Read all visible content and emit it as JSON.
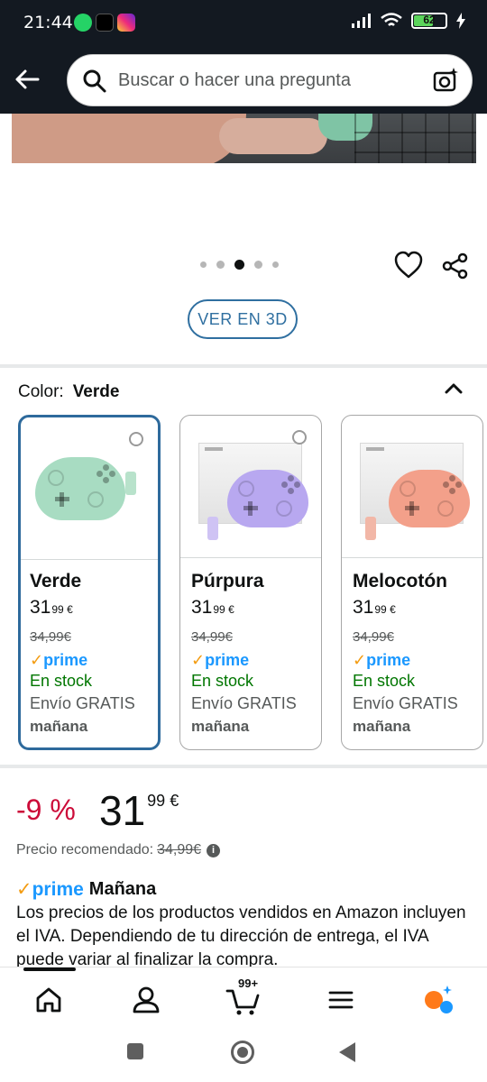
{
  "status_bar": {
    "time": "21:44",
    "battery": "62",
    "battery_level": 0.62
  },
  "search": {
    "placeholder": "Buscar o hacer una pregunta"
  },
  "carousel": {
    "dot_count": 5,
    "active_index": 2,
    "view_3d_label": "VER EN 3D"
  },
  "color": {
    "label": "Color:",
    "selected": "Verde"
  },
  "variants": [
    {
      "name": "Verde",
      "price_whole": "31",
      "price_cents": "99",
      "currency": "€",
      "old_price": "34,99€",
      "prime_check": "✓",
      "prime_word": "prime",
      "stock": "En stock",
      "shipping": "Envío GRATIS",
      "delivery": "mañana",
      "color": "#a8dcc2"
    },
    {
      "name": "Púrpura",
      "price_whole": "31",
      "price_cents": "99",
      "currency": "€",
      "old_price": "34,99€",
      "prime_check": "✓",
      "prime_word": "prime",
      "stock": "En stock",
      "shipping": "Envío GRATIS",
      "delivery": "mañana",
      "color": "#b8a8f0"
    },
    {
      "name": "Melocotón",
      "price_whole": "31",
      "price_cents": "99",
      "currency": "€",
      "old_price": "34,99€",
      "prime_check": "✓",
      "prime_word": "prime",
      "stock": "En stock",
      "shipping": "Envío GRATIS",
      "delivery": "mañana",
      "color": "#f3a08a"
    }
  ],
  "price": {
    "discount": "-9 %",
    "whole": "31",
    "cents": "99 €",
    "recommended_label": "Precio recomendado:",
    "recommended_value": "34,99€",
    "info_glyph": "i"
  },
  "prime_delivery": {
    "check": "✓",
    "prime_word": "prime",
    "day": "Mañana"
  },
  "vat_notice": "Los precios de los productos vendidos en Amazon incluyen el IVA. Dependiendo de tu dirección de entrega, el IVA puede variar al finalizar la compra.",
  "nav": {
    "cart_count": "99+"
  },
  "colors": {
    "header_bg": "#131921",
    "accent_blue": "#2f6fa0",
    "discount_red": "#cc0c39",
    "stock_green": "#007600",
    "prime_blue": "#1a98ff"
  }
}
